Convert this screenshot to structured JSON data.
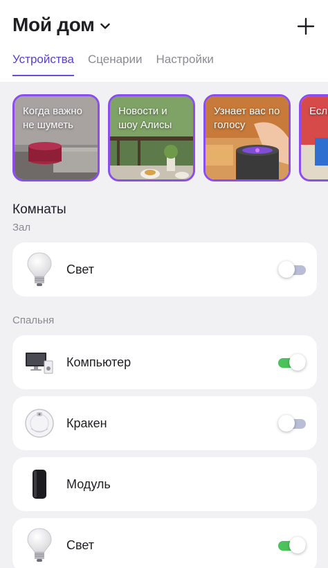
{
  "header": {
    "title": "Мой дом",
    "tabs": [
      {
        "label": "Устройства",
        "active": true
      },
      {
        "label": "Сценарии",
        "active": false
      },
      {
        "label": "Настройки",
        "active": false
      }
    ]
  },
  "stories": [
    {
      "label": "Когда важно не шуметь"
    },
    {
      "label": "Новости и шоу Алисы"
    },
    {
      "label": "Узнает вас по голосу"
    },
    {
      "label": "Если ребе"
    }
  ],
  "rooms_title": "Комнаты",
  "rooms": [
    {
      "name": "Зал",
      "devices": [
        {
          "name": "Свет",
          "icon": "bulb-icon",
          "toggle": "off"
        }
      ]
    },
    {
      "name": "Спальня",
      "devices": [
        {
          "name": "Компьютер",
          "icon": "computer-icon",
          "toggle": "on"
        },
        {
          "name": "Кракен",
          "icon": "robot-vacuum-icon",
          "toggle": "off"
        },
        {
          "name": "Модуль",
          "icon": "module-icon",
          "toggle": null
        },
        {
          "name": "Свет",
          "icon": "bulb-icon",
          "toggle": "on"
        }
      ]
    }
  ],
  "colors": {
    "accent": "#6a4be0",
    "story_border": "#8b4df0",
    "toggle_on": "#4cc25a",
    "toggle_off": "#b9bdd6",
    "background": "#f1f1f4"
  }
}
